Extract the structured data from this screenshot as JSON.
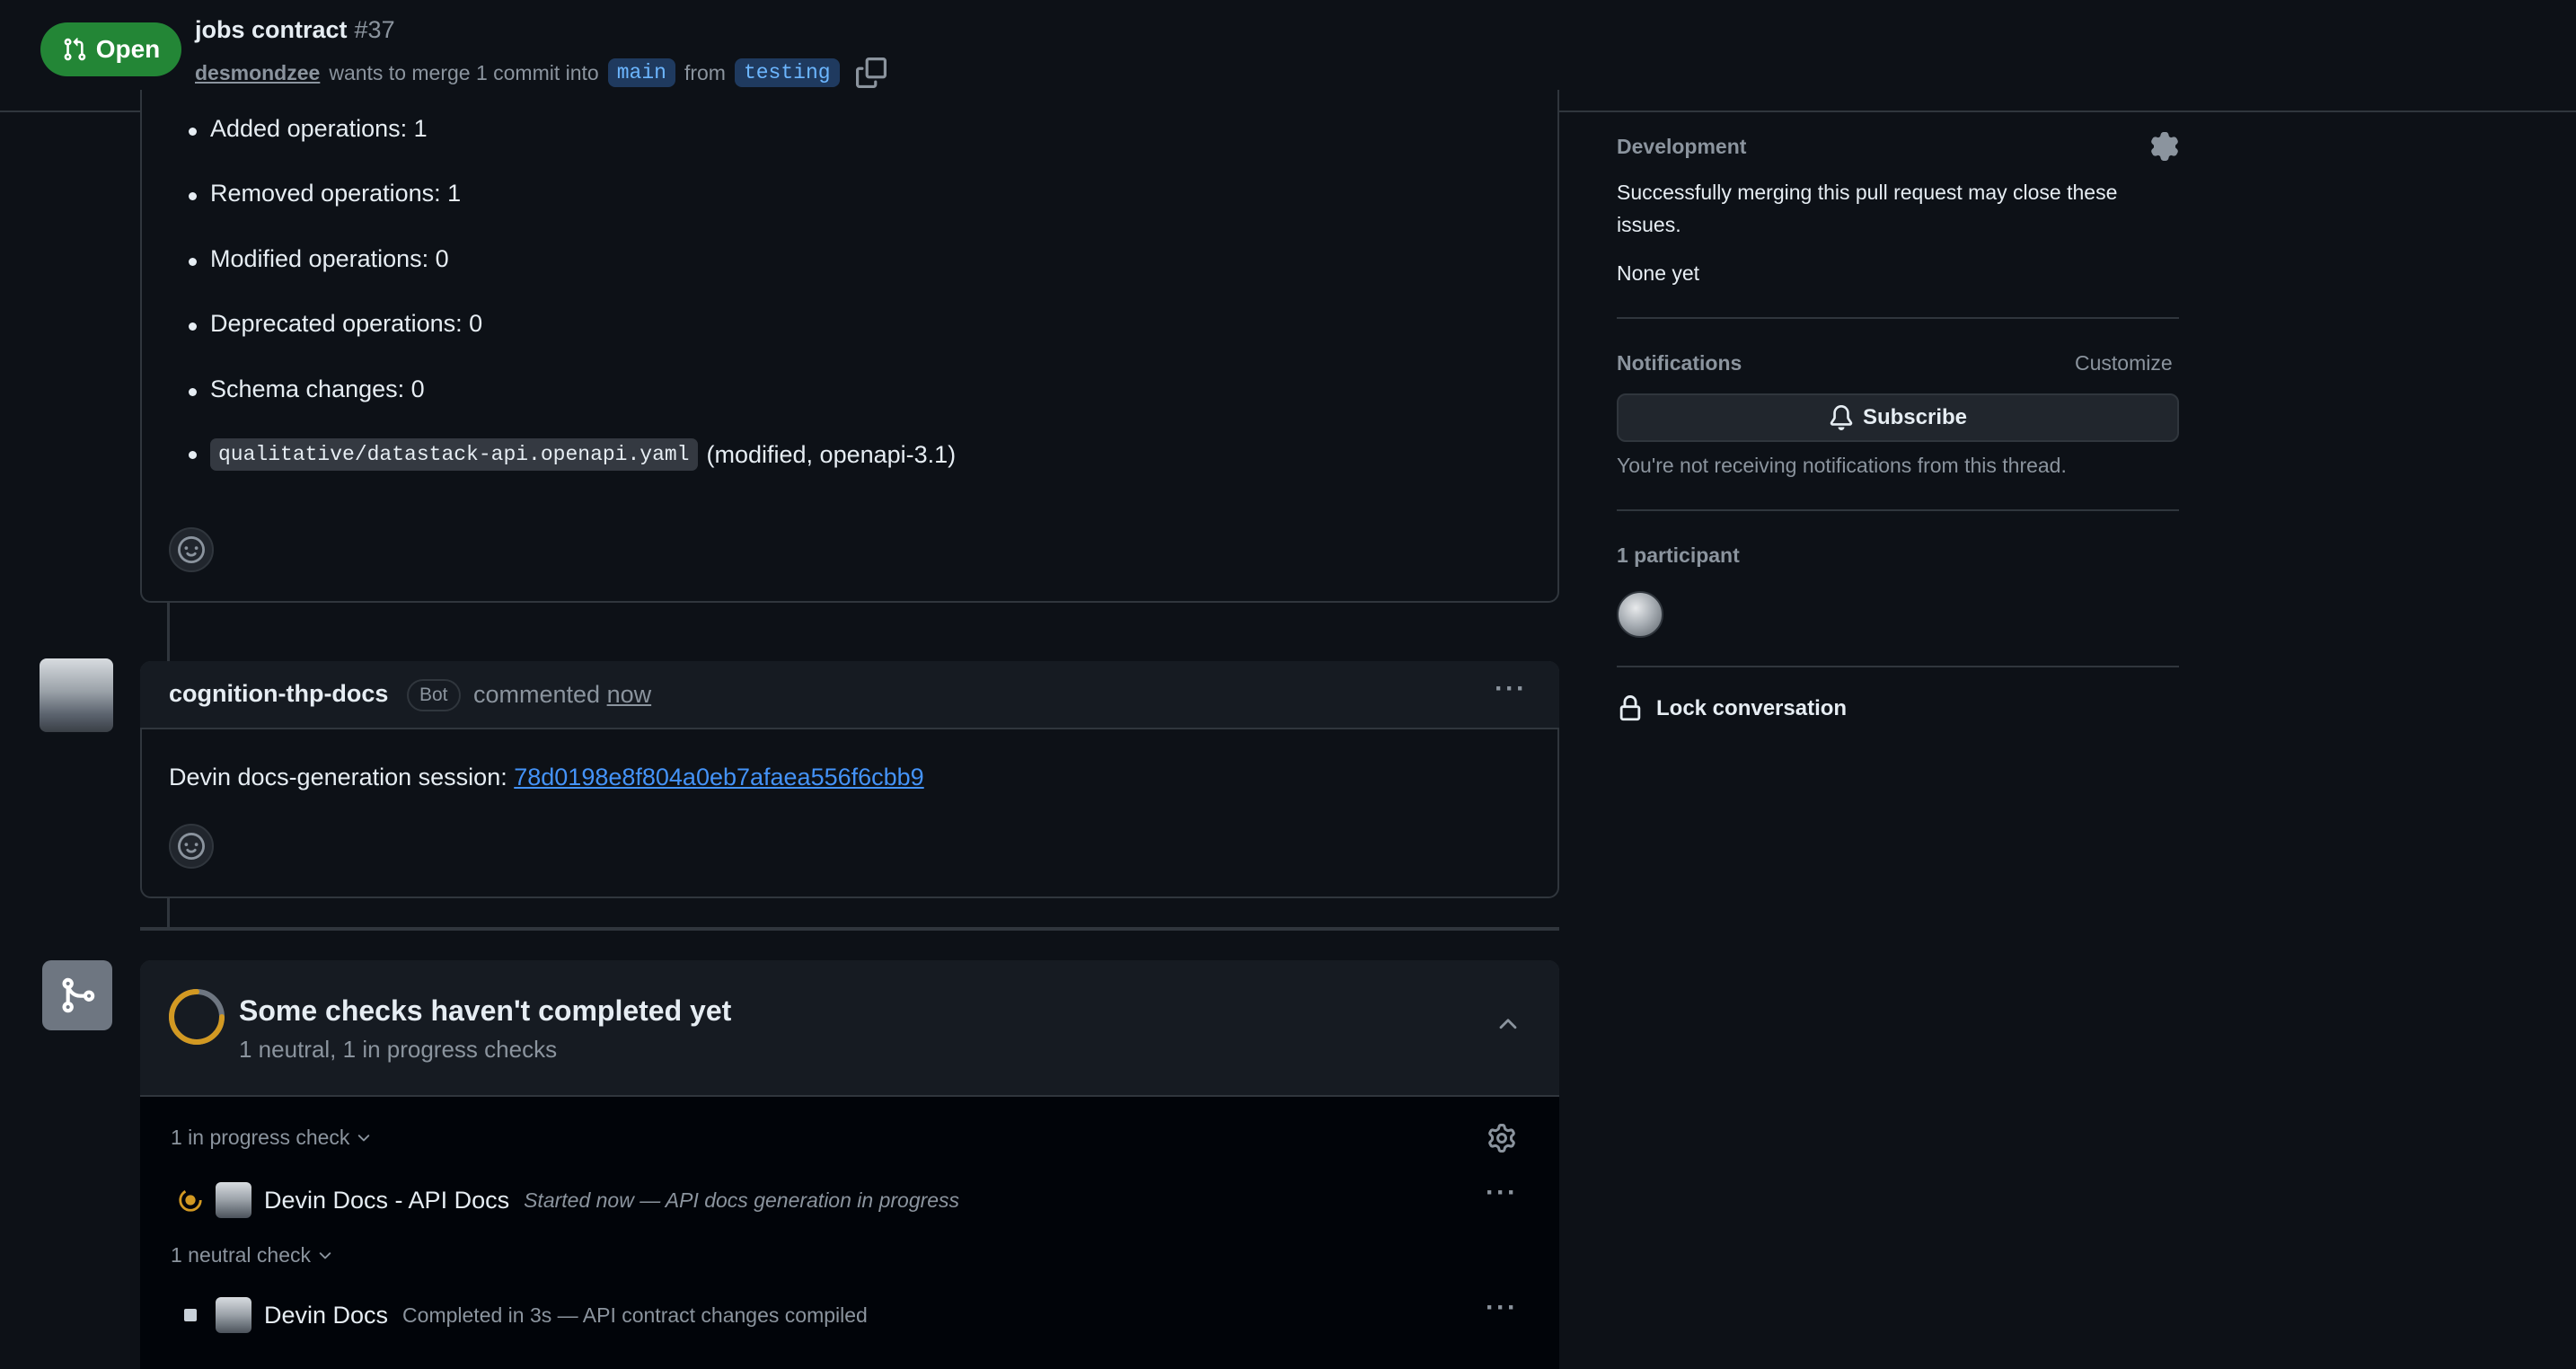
{
  "header": {
    "state_badge": "Open",
    "title": "jobs contract",
    "number": "#37",
    "author": "desmondzee",
    "merge_text": "wants to merge 1 commit into",
    "base_branch": "main",
    "from_text": "from",
    "head_branch": "testing"
  },
  "summary_comment": {
    "bullets": [
      "Added operations: 1",
      "Removed operations: 1",
      "Modified operations: 0",
      "Deprecated operations: 0",
      "Schema changes: 0"
    ],
    "file_path": "qualitative/datastack-api.openapi.yaml",
    "file_note": "(modified, openapi-3.1)"
  },
  "bot_comment": {
    "author": "cognition-thp-docs",
    "badge": "Bot",
    "action": "commented",
    "time": "now",
    "body_prefix": "Devin docs-generation session:",
    "session_link": "78d0198e8f804a0eb7afaea556f6cbb9"
  },
  "checks": {
    "title": "Some checks haven't completed yet",
    "subtitle": "1 neutral, 1 in progress checks",
    "groups": [
      {
        "label": "1 in progress check",
        "status": "in-progress",
        "name": "Devin Docs - API Docs",
        "description": "Started now — API docs generation in progress"
      },
      {
        "label": "1 neutral check",
        "status": "neutral",
        "name": "Devin Docs",
        "description": "Completed in 3s — API contract changes compiled"
      }
    ]
  },
  "sidebar": {
    "development": {
      "label": "Development",
      "text": "Successfully merging this pull request may close these issues.",
      "none": "None yet"
    },
    "notifications": {
      "label": "Notifications",
      "customize": "Customize",
      "subscribe": "Subscribe",
      "note": "You're not receiving notifications from this thread."
    },
    "participants": {
      "label": "1 participant"
    },
    "lock": "Lock conversation"
  },
  "colors": {
    "background": "#0d1117",
    "open_green": "#238636",
    "link_blue": "#4493f8",
    "in_progress_yellow": "#d29922",
    "border": "#30363d"
  }
}
